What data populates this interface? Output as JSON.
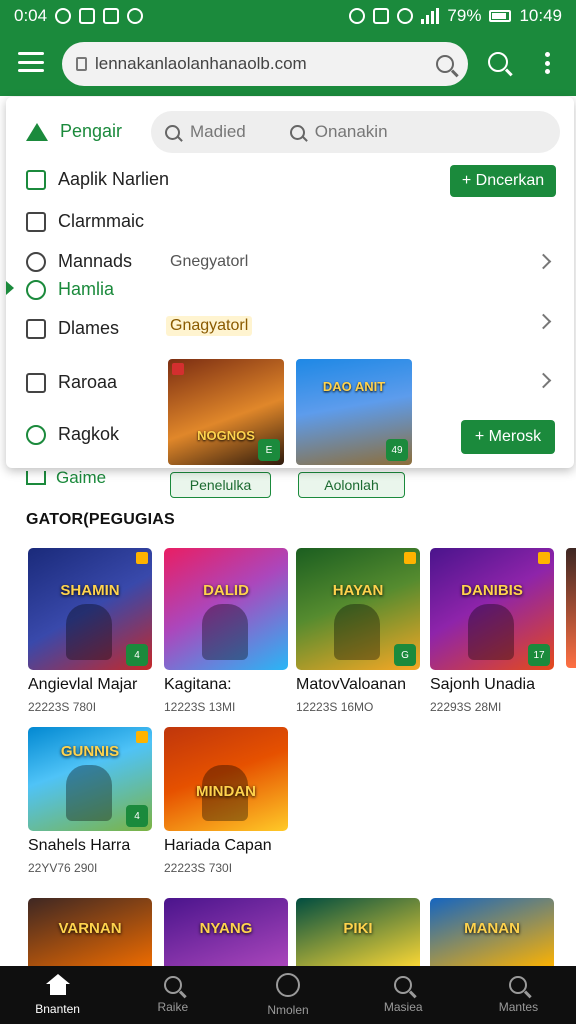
{
  "status_bar": {
    "time_left": "0:04",
    "battery": "79%",
    "clock": "10:49"
  },
  "app_bar": {
    "url": "lennakanlaolanhanaolb.com"
  },
  "menu_panel": {
    "header_label": "Pengair",
    "search_items": [
      "Madied",
      "Onanakin"
    ],
    "rows": [
      {
        "label": "Aaplik Narlien",
        "icon": "tablet-icon"
      },
      {
        "label": "Clarmmaic",
        "icon": "document-icon"
      },
      {
        "label": "Mannads",
        "icon": "anchor-icon",
        "sub": "Gnegyatorl"
      },
      {
        "label": "Hamlia",
        "icon": "link-icon",
        "selected": true
      },
      {
        "label": "Dlames",
        "icon": "checkbox-icon",
        "sub": "Gnagyatorl"
      },
      {
        "label": "Raroaa",
        "icon": "square-icon"
      },
      {
        "label": "Ragkok",
        "icon": "search-icon"
      }
    ],
    "primary_button": "+ Dncerkan",
    "secondary_button": "+ Merosk",
    "thumbnails": [
      {
        "title": "NOGNOS",
        "badge": "E"
      },
      {
        "title": "DAO ANIT",
        "badge": "49"
      }
    ]
  },
  "games_row": {
    "label": "Gaime",
    "chips": [
      "Penelulka",
      "Aolonlah"
    ]
  },
  "section": {
    "title": "GATOR(PEGUGIAS"
  },
  "games": [
    {
      "title": "Angievlal Majar",
      "meta": "22223S 780I",
      "art": "SHAMIN",
      "badge": "4",
      "c1": "#1a2a7a",
      "c2": "#c62828"
    },
    {
      "title": "Kagitana:",
      "meta": "12223S 13MI",
      "art": "DALID",
      "badge": "",
      "c1": "#e91e63",
      "c2": "#29b6f6"
    },
    {
      "title": "MatovValoanan",
      "meta": "12223S 16MO",
      "art": "HAYAN",
      "badge": "G",
      "c1": "#1b5e20",
      "c2": "#f9a825"
    },
    {
      "title": "Sajonh Unadia",
      "meta": "22293S 28MI",
      "art": "DANIBIS",
      "badge": "17",
      "c1": "#4a148c",
      "c2": "#e64a19"
    },
    {
      "title": "Snahels Harra",
      "meta": "22YV76 290I",
      "art": "GUNNIS",
      "badge": "4",
      "c1": "#0288d1",
      "c2": "#7cb342"
    },
    {
      "title": "Hariada Capan",
      "meta": "22223S 730I",
      "art": "MINDAN",
      "badge": "",
      "c1": "#bf360c",
      "c2": "#ffca28"
    }
  ],
  "bottom_row": [
    {
      "art": "VARNAN",
      "c1": "#3e2723",
      "c2": "#ef6c00"
    },
    {
      "art": "NYANG",
      "c1": "#4a148c",
      "c2": "#ab47bc"
    },
    {
      "art": "PIKI",
      "c1": "#004d40",
      "c2": "#fdd835"
    },
    {
      "art": "MANAN",
      "c1": "#1565c0",
      "c2": "#ffb300"
    }
  ],
  "bottom_nav": [
    {
      "label": "Bnanten",
      "icon": "home-icon",
      "active": true
    },
    {
      "label": "Raike",
      "icon": "search-icon",
      "active": false
    },
    {
      "label": "Nmolen",
      "icon": "circle-icon",
      "active": false
    },
    {
      "label": "Masiea",
      "icon": "search-icon",
      "active": false
    },
    {
      "label": "Mantes",
      "icon": "search-icon",
      "active": false
    }
  ],
  "colors": {
    "brand_green": "#1b8a3c",
    "nav_background": "#0f0f0f"
  }
}
